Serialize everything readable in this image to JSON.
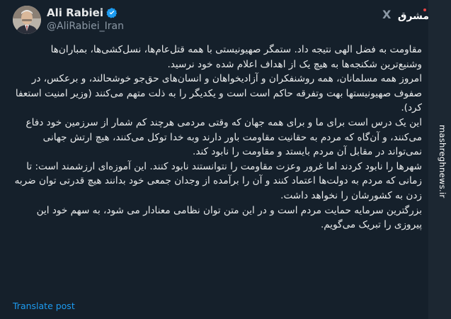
{
  "author": {
    "name": "Ali Rabiei",
    "handle": "@AliRabiei_Iran"
  },
  "header": {
    "x_logo": "X",
    "brand_logo": "مشرق"
  },
  "tweet": {
    "paragraphs": [
      "مقاومت به فضل الهی نتیجه داد. ستمگر صهیونیستی با همه قتل‌عام‌ها، نسل‌کشی‌ها، بمباران‌ها وشنیع‌ترین شکنجه‌ها به هیچ یک از اهداف اعلام شده خود نرسید.",
      "امروز همه مسلمانان، همه روشنفکران و آزادیخواهان و انسان‌های حق‌جو خوشحالند، و برعکس، در صفوف صهیونیستها بهت وتفرقه حاکم است است و یکدیگر را به ذلت متهم می‌کنند (وزیر امنیت استعفا کرد).",
      "این یک درس است برای ما و برای همه جهان که وقتی مردمی هرچند کم شمار از سرزمین خود دفاع می‌کنند، و آن‌گاه که مردم به حقانیت مقاومت باور دارند وبه خدا توکل می‌کنند، هیچ ارتش جهانی نمی‌تواند در مقابل آن مردم بایستد و مقاومت را نابود کند.",
      "شهرها را نابود کردند اما غرور وعزت مقاومت را نتوانستند نابود کنند. این آموزه‌ای ارزشمند است: تا زمانی که مردم  به دولت‌ها اعتماد کنند و آن را برآمده از وجدان جمعی خود بدانند هیچ قدرتی توان ضربه زدن به کشورشان را نخواهد داشت.",
      "بزرگترین سرمایه حمایت مردم است و در این متن توان نظامی معنادار می شود، به سهم خود این پیروزی را تبریک می‌گویم."
    ],
    "translate_label": "Translate post"
  },
  "watermark": "mashreghnews.ir",
  "colors": {
    "background": "#15202b",
    "text": "#e7e9ea",
    "muted": "#8b98a5",
    "link": "#1d9bf0",
    "verified": "#1d9bf0"
  }
}
